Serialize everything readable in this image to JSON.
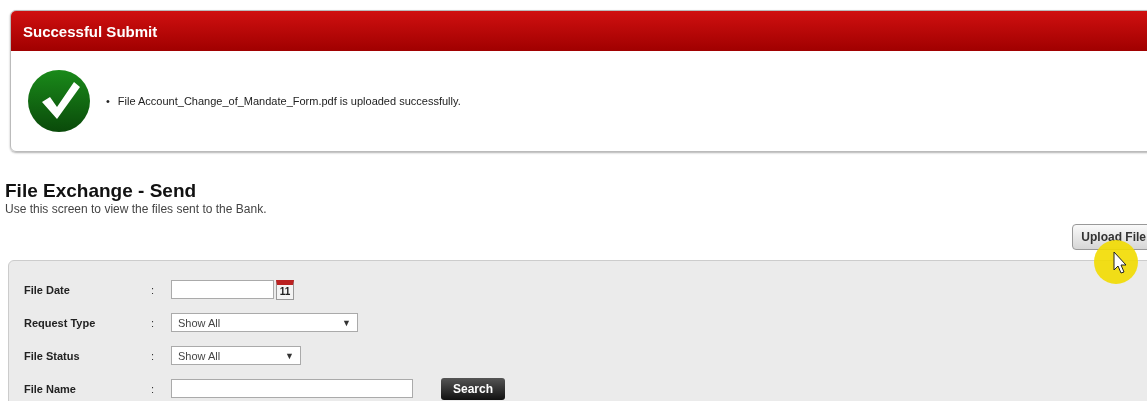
{
  "alert": {
    "title": "Successful Submit",
    "bullet": "•",
    "messages": [
      "File Account_Change_of_Mandate_Form.pdf is uploaded successfully."
    ]
  },
  "page": {
    "title": "File Exchange - Send",
    "subtitle": "Use this screen to view the files sent to the Bank."
  },
  "upload_button": "Upload File",
  "filters": [
    {
      "kind": "date",
      "label": "File Date",
      "separator": ":"
    },
    {
      "kind": "select",
      "label": "Request Type",
      "separator": ":",
      "value": "Show All",
      "caret": "▼",
      "wide": true
    },
    {
      "kind": "select",
      "label": "File Status",
      "separator": ":",
      "value": "Show All",
      "caret": "▼",
      "wide": false
    },
    {
      "kind": "text",
      "label": "File Name",
      "separator": ":",
      "button": "Search"
    }
  ],
  "calendar_day": "11"
}
